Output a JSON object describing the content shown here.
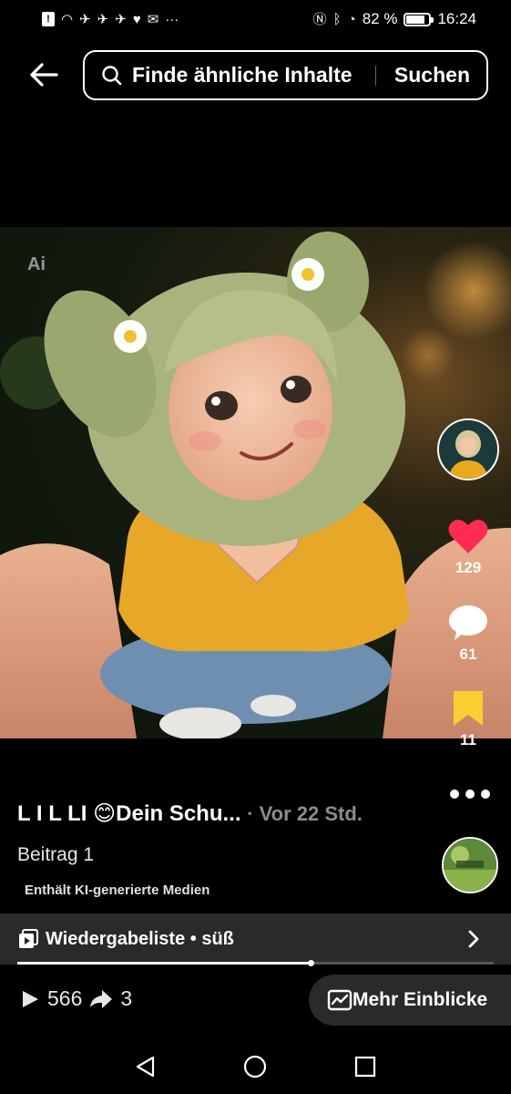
{
  "status_bar": {
    "battery": "82 %",
    "time": "16:24"
  },
  "search": {
    "placeholder": "Finde ähnliche Inhalte",
    "button_label": "Suchen"
  },
  "media": {
    "ai_badge": "Ai"
  },
  "actions": {
    "likes": "129",
    "comments": "61",
    "saves": "11",
    "like_color": "#fe2c55",
    "save_color": "#facd30"
  },
  "post": {
    "title": "L I L LI 😊Dein Schu...",
    "time": "· Vor 22 Std.",
    "label": "Beitrag 1",
    "ai_notice": "Enthält KI-generierte Medien"
  },
  "playlist": {
    "label": "Wiedergabeliste • süß"
  },
  "playback": {
    "progress": 0.615
  },
  "stats": {
    "plays": "566",
    "shares": "3"
  },
  "insights": {
    "label": "Mehr Einblicke"
  }
}
